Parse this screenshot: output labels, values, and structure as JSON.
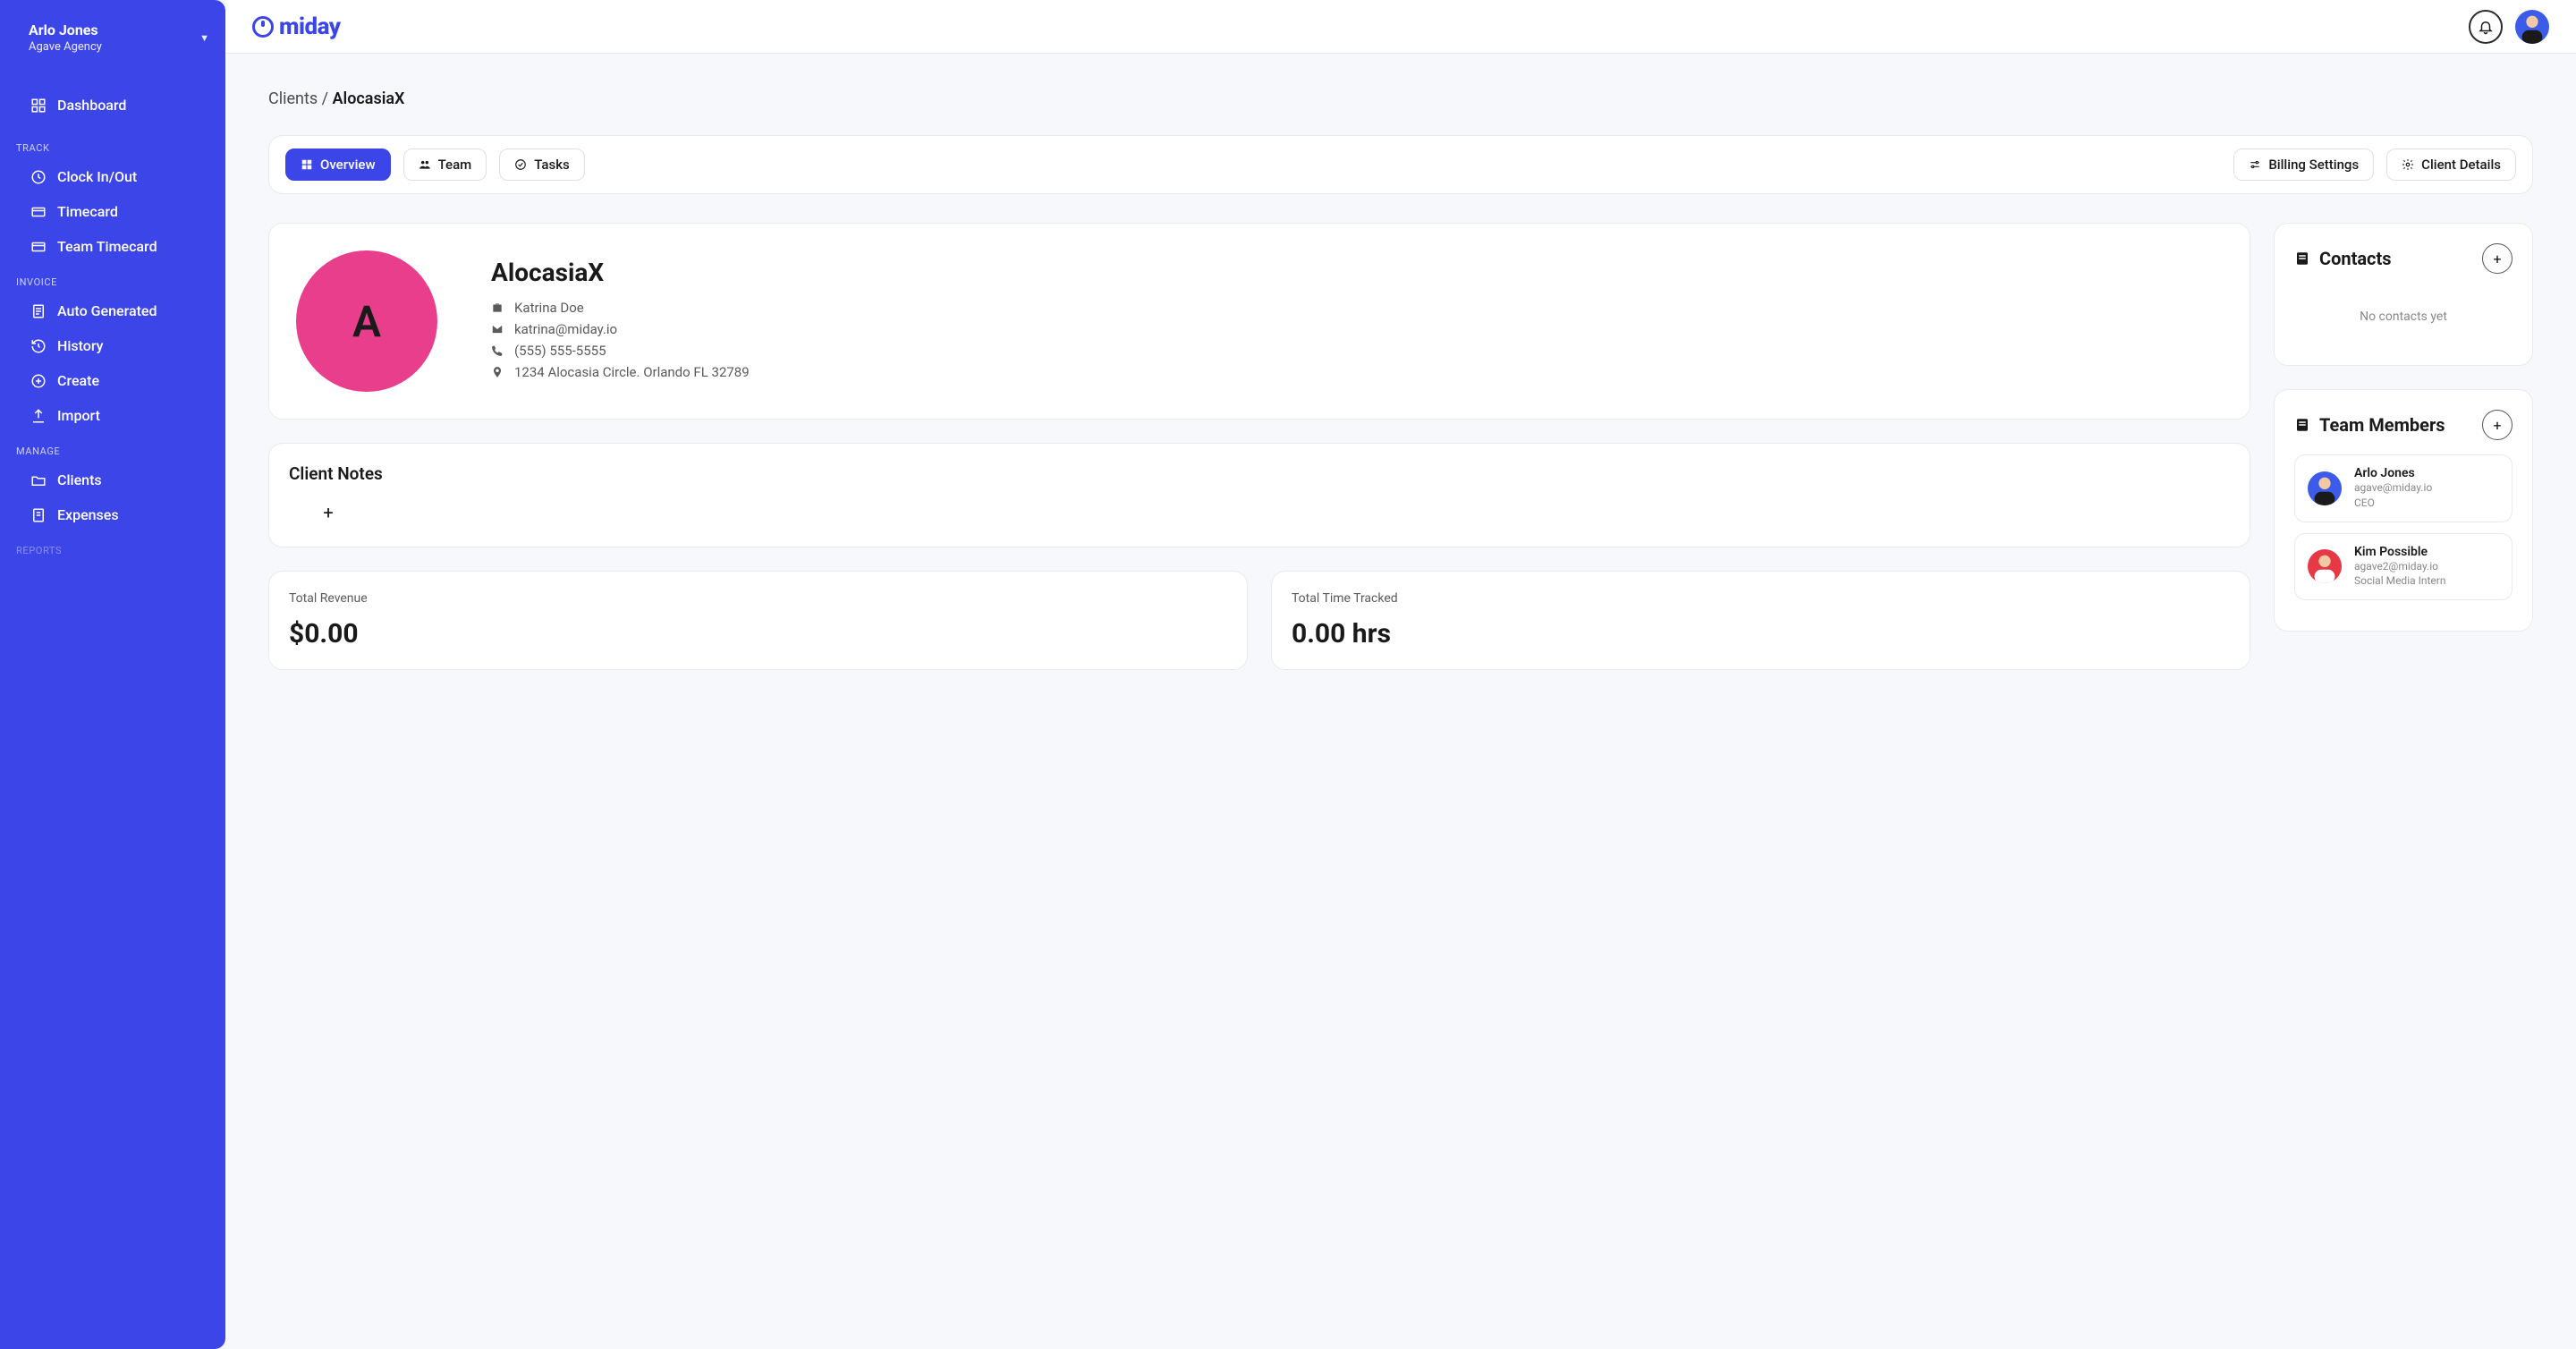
{
  "user": {
    "name": "Arlo Jones",
    "org": "Agave Agency"
  },
  "brand": "miday",
  "nav": {
    "dashboard": "Dashboard",
    "track_heading": "TRACK",
    "clockinout": "Clock In/Out",
    "timecard": "Timecard",
    "team_timecard": "Team Timecard",
    "invoice_heading": "INVOICE",
    "auto_generated": "Auto Generated",
    "history": "History",
    "create": "Create",
    "import": "Import",
    "manage_heading": "MANAGE",
    "clients": "Clients",
    "expenses": "Expenses",
    "reports_heading": "REPORTS"
  },
  "breadcrumb": {
    "root": "Clients",
    "sep": "/",
    "current": "AlocasiaX"
  },
  "tabs": {
    "overview": "Overview",
    "team": "Team",
    "tasks": "Tasks",
    "billing_settings": "Billing Settings",
    "client_details": "Client Details"
  },
  "client": {
    "avatar_letter": "A",
    "name": "AlocasiaX",
    "person": "Katrina Doe",
    "email": "katrina@miday.io",
    "phone": "(555) 555-5555",
    "address": "1234 Alocasia Circle. Orlando FL 32789"
  },
  "notes": {
    "title": "Client Notes"
  },
  "stats": {
    "revenue_label": "Total Revenue",
    "revenue_value": "$0.00",
    "time_label": "Total Time Tracked",
    "time_value": "0.00 hrs"
  },
  "contacts": {
    "title": "Contacts",
    "empty": "No contacts yet"
  },
  "members": {
    "title": "Team Members",
    "list": [
      {
        "name": "Arlo Jones",
        "email": "agave@miday.io",
        "role": "CEO"
      },
      {
        "name": "Kim Possible",
        "email": "agave2@miday.io",
        "role": "Social Media Intern"
      }
    ]
  }
}
